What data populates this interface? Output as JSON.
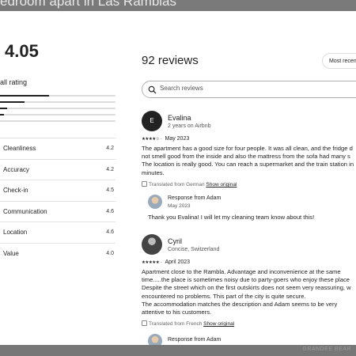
{
  "page": {
    "title": "edroom apart in Las Ramblas"
  },
  "overall": {
    "score": "4.05",
    "label": "all rating",
    "distribution": [
      0.5,
      0.25,
      0.07,
      0.04,
      0.0
    ]
  },
  "categories": [
    {
      "label": "Cleanliness",
      "value": "4.2"
    },
    {
      "label": "Accuracy",
      "value": "4.2"
    },
    {
      "label": "Check-in",
      "value": "4.5"
    },
    {
      "label": "Communication",
      "value": "4.6"
    },
    {
      "label": "Location",
      "value": "4.6"
    },
    {
      "label": "Value",
      "value": "4.0"
    }
  ],
  "reviews_header": {
    "count": "92 reviews",
    "sort_label": "Most recent"
  },
  "search": {
    "placeholder": "Search reviews"
  },
  "reviews": [
    {
      "avatar_letter": "E",
      "name": "Evalina",
      "sub": "2 years on Airbnb",
      "stars": "★★★★☆",
      "date": "May 2023",
      "lines": [
        "The apartment has a good size for four people. It was all clean, and the fridge d",
        "not smell good from the inside and also the mattress from the sofa had many s",
        "The location is really good. You can reach a supermarket and the train station in",
        "minutes."
      ],
      "translated": "Translated from German",
      "show_original": "Show original",
      "response": {
        "title": "Response from Adam",
        "date": "May 2023",
        "text": "Thank you Evalina! I will let my cleaning team know about this!"
      }
    },
    {
      "name": "Cyril",
      "sub": "Concise, Switzerland",
      "stars": "★★★★★",
      "date": "April 2023",
      "lines": [
        "Apartment close to the Rambla. Advantage and inconvenience at the same",
        "time.....the place is sometimes noisy due to party-goers who enjoy these place",
        "Despite the street which on the first outskirts does not seem very reassuring, w",
        "encountered no problems. This part of the city is quite secure.",
        "The accommodation matches the description and Adam seems to be very",
        "attentive to his customers."
      ],
      "translated": "Translated from French",
      "show_original": "Show original",
      "response": {
        "title": "Response from Adam"
      }
    }
  ],
  "footer": {
    "watermark": "GRANDEE BEAR"
  }
}
